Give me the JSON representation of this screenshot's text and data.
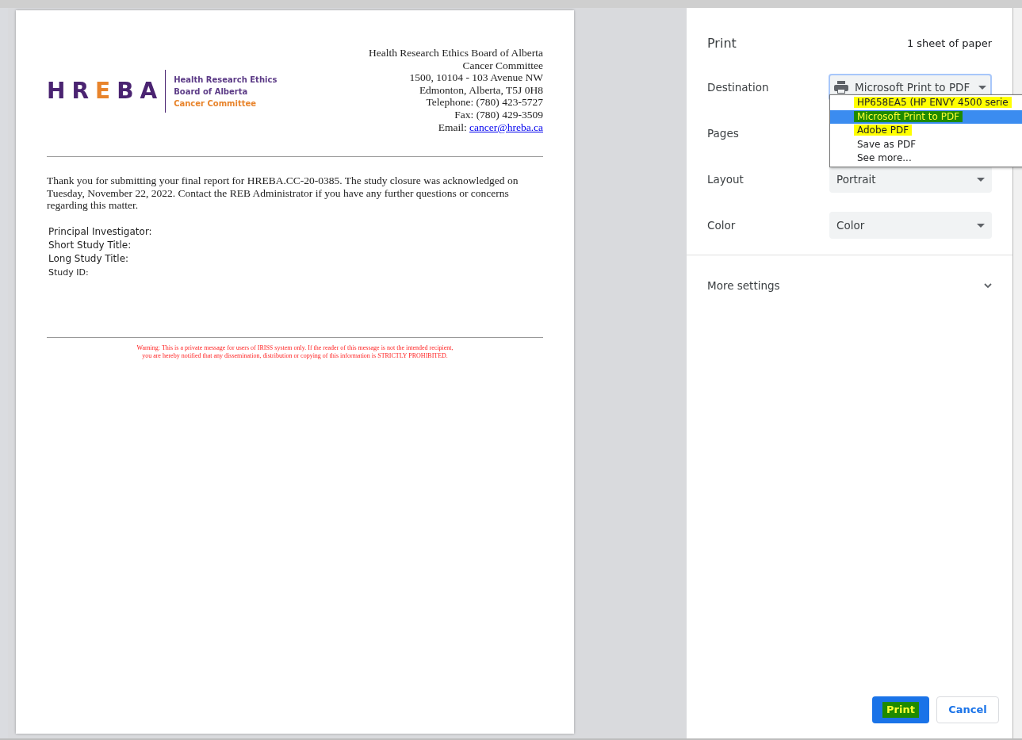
{
  "document": {
    "logo": {
      "wordmark": [
        {
          "letter": "H",
          "accent": false
        },
        {
          "letter": "R",
          "accent": false
        },
        {
          "letter": "E",
          "accent": true
        },
        {
          "letter": "B",
          "accent": false
        },
        {
          "letter": "A",
          "accent": false
        }
      ],
      "lines": [
        "Health Research Ethics",
        "Board of Alberta",
        "Cancer Committee"
      ]
    },
    "address": [
      "Health Research Ethics Board of Alberta",
      "Cancer Committee",
      "1500, 10104 - 103 Avenue NW",
      "Edmonton, Alberta, T5J 0H8",
      "Telephone: (780) 423-5727",
      "Fax: (780) 429-3509"
    ],
    "email": {
      "label": "Email: ",
      "link": "cancer@hreba.ca"
    },
    "body": "Thank you for submitting your final report for HREBA.CC-20-0385. The study closure was acknowledged on Tuesday, November 22, 2022. Contact the REB Administrator if you have any further questions or concerns regarding this matter.",
    "fields": [
      "Principal Investigator:",
      "Short Study Title:",
      "Long Study Title:",
      "Study ID:"
    ],
    "warning": [
      "Warning: This is a private message for users of IRISS system only. If the reader of this message is not the intended recipient,",
      "you are hereby notified that any dissemination, distribution or copying of this information is STRICTLY PROHIBITED."
    ]
  },
  "panel": {
    "title": "Print",
    "sheets": "1 sheet of paper",
    "settings": [
      {
        "label": "Destination",
        "value": "Microsoft Print to PDF",
        "kind": "printer"
      },
      {
        "label": "Pages",
        "kind": "covered"
      },
      {
        "label": "Layout",
        "value": "Portrait",
        "kind": "select"
      },
      {
        "label": "Color",
        "value": "Color",
        "kind": "select"
      }
    ],
    "more_settings": "More settings",
    "dropdown": [
      {
        "label": "HP658EA5 (HP ENVY 4500 serie",
        "selected": false,
        "color": "#ffff00"
      },
      {
        "label": "Microsoft Print to PDF",
        "selected": true,
        "color": "#1e8a00"
      },
      {
        "label": "Adobe PDF",
        "selected": false,
        "color": "#ffff00"
      },
      {
        "label": "Save as PDF",
        "selected": false
      },
      {
        "label": "See more...",
        "selected": false
      }
    ],
    "print_button": {
      "label": "Print",
      "color": "#1e8a00"
    },
    "cancel_button": "Cancel"
  }
}
